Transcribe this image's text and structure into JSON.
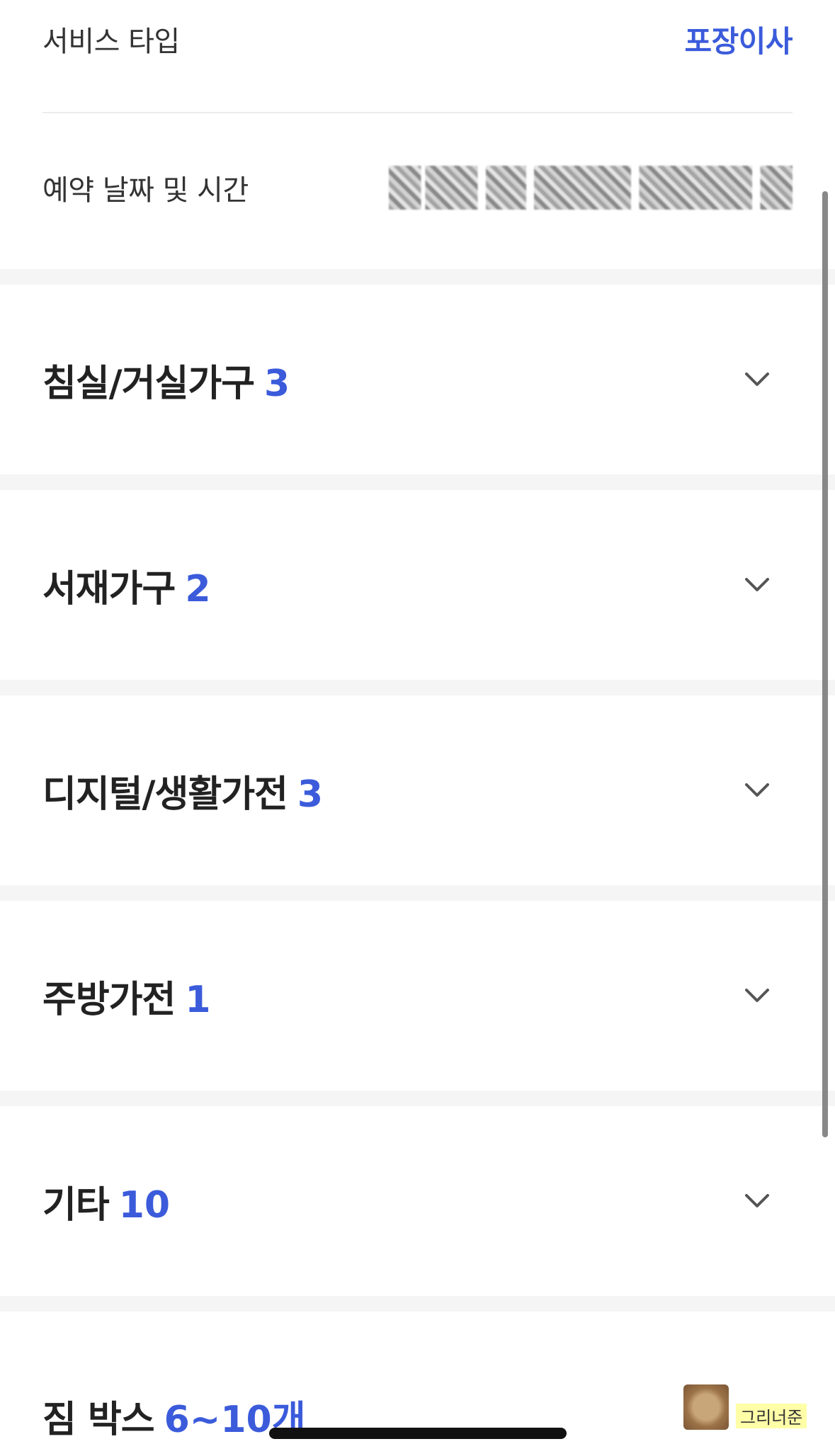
{
  "info": {
    "service_label": "서비스 타입",
    "service_value": "포장이사",
    "reservation_label": "예약 날짜 및 시간"
  },
  "sections": [
    {
      "title": "침실/거실가구",
      "count": "3"
    },
    {
      "title": "서재가구",
      "count": "2"
    },
    {
      "title": "디지털/생활가전",
      "count": "3"
    },
    {
      "title": "주방가전",
      "count": "1"
    },
    {
      "title": "기타",
      "count": "10"
    },
    {
      "title": "짐 박스",
      "count": "6~10개"
    }
  ],
  "watermark": {
    "text": "그리너준"
  },
  "colors": {
    "accent": "#3b5bdb",
    "text": "#222222",
    "gap": "#f5f5f5"
  },
  "icons": {
    "expand": "chevron-down-icon"
  }
}
